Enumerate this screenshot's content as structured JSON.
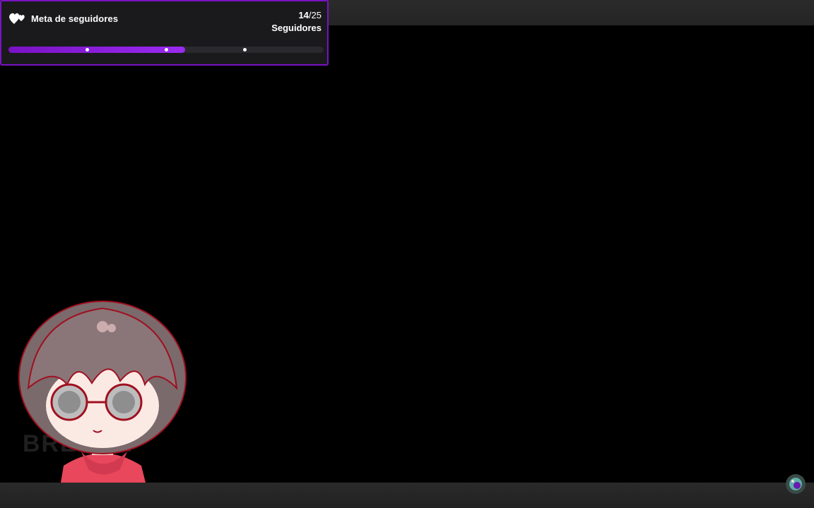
{
  "goal": {
    "title": "Meta de seguidores",
    "current": "14",
    "separator": "/",
    "target": "25",
    "unit": "Seguidores",
    "progress_fraction": 0.56,
    "milestone_fractions": [
      0.25,
      0.5,
      0.75
    ],
    "accent_color": "#7a12c4",
    "icon": "hearts-icon"
  },
  "overlay": {
    "avatar_icon": "chibi-avatar-icon",
    "watermark": "BREHAN",
    "corner_icon": "channel-logo-icon"
  }
}
